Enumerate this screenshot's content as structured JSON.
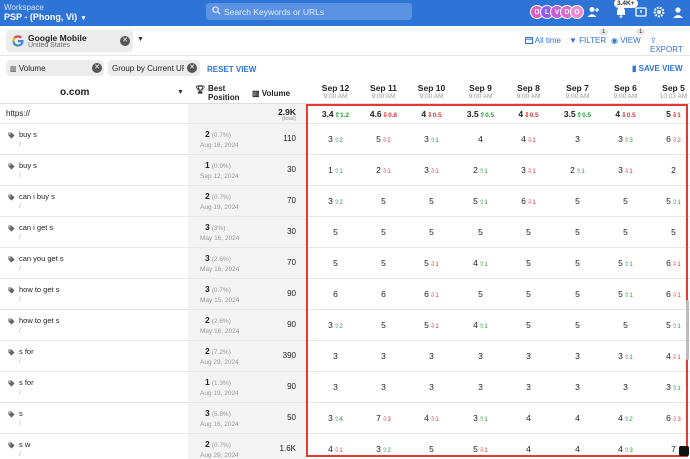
{
  "topbar": {
    "workspace_label": "Workspace",
    "workspace_name": "PSP - (Phong, Vi)",
    "search_placeholder": "Search Keywords or URLs",
    "avatars": [
      {
        "letter": "D",
        "color": "#e05cc8"
      },
      {
        "letter": "L",
        "color": "#8e5cf0"
      },
      {
        "letter": "V",
        "color": "#c85cd8"
      },
      {
        "letter": "D",
        "color": "#d86ad0"
      },
      {
        "letter": "O",
        "color": "#e88ad8"
      }
    ],
    "notif_badge": "3.4K+"
  },
  "filterbar": {
    "engine_name": "Google Mobile",
    "engine_location": "United States",
    "all_time": "All time",
    "filter": "FILTER",
    "filter_count": "1",
    "view": "VIEW",
    "view_count": "1",
    "export": "EXPORT"
  },
  "secbar": {
    "chip_volume": "Volume",
    "chip_group": "Group by Current URL",
    "reset": "RESET VIEW",
    "save": "SAVE VIEW"
  },
  "table": {
    "domain": "o.com",
    "best_header_1": "Best",
    "best_header_2": "Position",
    "volume_header": "Volume",
    "dates": [
      {
        "date": "Sep 12",
        "time": "9:00 AM"
      },
      {
        "date": "Sep 11",
        "time": "9:00 AM"
      },
      {
        "date": "Sep 10",
        "time": "9:00 AM"
      },
      {
        "date": "Sep 9",
        "time": "9:00 AM"
      },
      {
        "date": "Sep 8",
        "time": "9:00 AM"
      },
      {
        "date": "Sep 7",
        "time": "9:00 AM"
      },
      {
        "date": "Sep 6",
        "time": "9:00 AM"
      },
      {
        "date": "Sep 5",
        "time": "10:03 AM"
      }
    ],
    "top_row": {
      "url": "https://",
      "total": "2.9K",
      "total_label": "(total)",
      "cells": [
        {
          "v": "3.4",
          "c": "1.2",
          "d": "up"
        },
        {
          "v": "4.6",
          "c": "0.6",
          "d": "dn"
        },
        {
          "v": "4",
          "c": "0.5",
          "d": "dn"
        },
        {
          "v": "3.5",
          "c": "0.5",
          "d": "up"
        },
        {
          "v": "4",
          "c": "0.5",
          "d": "dn"
        },
        {
          "v": "3.5",
          "c": "0.5",
          "d": "up"
        },
        {
          "v": "4",
          "c": "0.5",
          "d": "dn"
        },
        {
          "v": "5",
          "c": "1",
          "d": "dn"
        }
      ]
    },
    "rows": [
      {
        "kw": "buy s",
        "url": "/",
        "best": "2",
        "pct": "(0.7%)",
        "bdate": "Aug 16, 2024",
        "vol": "110",
        "cells": [
          {
            "v": "3",
            "c": "2",
            "d": "up"
          },
          {
            "v": "5",
            "c": "2",
            "d": "dn"
          },
          {
            "v": "3",
            "c": "1",
            "d": "up"
          },
          {
            "v": "4",
            "c": "",
            "d": ""
          },
          {
            "v": "4",
            "c": "1",
            "d": "dn"
          },
          {
            "v": "3",
            "c": "",
            "d": ""
          },
          {
            "v": "3",
            "c": "3",
            "d": "up"
          },
          {
            "v": "6",
            "c": "2",
            "d": "dn"
          }
        ]
      },
      {
        "kw": "buy s",
        "url": "/",
        "best": "1",
        "pct": "(0.9%)",
        "bdate": "Sep 12, 2024",
        "vol": "30",
        "cells": [
          {
            "v": "1",
            "c": "1",
            "d": "up"
          },
          {
            "v": "2",
            "c": "1",
            "d": "dn"
          },
          {
            "v": "3",
            "c": "1",
            "d": "dn"
          },
          {
            "v": "2",
            "c": "1",
            "d": "up"
          },
          {
            "v": "3",
            "c": "1",
            "d": "dn"
          },
          {
            "v": "2",
            "c": "1",
            "d": "up"
          },
          {
            "v": "3",
            "c": "1",
            "d": "dn"
          },
          {
            "v": "2",
            "c": "",
            "d": ""
          }
        ]
      },
      {
        "kw": "can i buy s",
        "url": "/",
        "best": "2",
        "pct": "(0.7%)",
        "bdate": "Aug 19, 2024",
        "vol": "70",
        "cells": [
          {
            "v": "3",
            "c": "2",
            "d": "up"
          },
          {
            "v": "5",
            "c": "",
            "d": ""
          },
          {
            "v": "5",
            "c": "",
            "d": ""
          },
          {
            "v": "5",
            "c": "1",
            "d": "up"
          },
          {
            "v": "6",
            "c": "1",
            "d": "dn"
          },
          {
            "v": "5",
            "c": "",
            "d": ""
          },
          {
            "v": "5",
            "c": "",
            "d": ""
          },
          {
            "v": "5",
            "c": "1",
            "d": "up"
          }
        ]
      },
      {
        "kw": "can i get s",
        "url": "/",
        "best": "3",
        "pct": "(3%)",
        "bdate": "May 16, 2024",
        "vol": "30",
        "cells": [
          {
            "v": "5",
            "c": "",
            "d": ""
          },
          {
            "v": "5",
            "c": "",
            "d": ""
          },
          {
            "v": "5",
            "c": "",
            "d": ""
          },
          {
            "v": "5",
            "c": "",
            "d": ""
          },
          {
            "v": "5",
            "c": "",
            "d": ""
          },
          {
            "v": "5",
            "c": "",
            "d": ""
          },
          {
            "v": "5",
            "c": "",
            "d": ""
          },
          {
            "v": "5",
            "c": "",
            "d": ""
          }
        ]
      },
      {
        "kw": "can you get s",
        "url": "/",
        "best": "3",
        "pct": "(2.6%)",
        "bdate": "May 16, 2024",
        "vol": "70",
        "cells": [
          {
            "v": "5",
            "c": "",
            "d": ""
          },
          {
            "v": "5",
            "c": "",
            "d": ""
          },
          {
            "v": "5",
            "c": "1",
            "d": "dn"
          },
          {
            "v": "4",
            "c": "1",
            "d": "up"
          },
          {
            "v": "5",
            "c": "",
            "d": ""
          },
          {
            "v": "5",
            "c": "",
            "d": ""
          },
          {
            "v": "5",
            "c": "1",
            "d": "up"
          },
          {
            "v": "6",
            "c": "1",
            "d": "dn"
          }
        ]
      },
      {
        "kw": "how to get s",
        "url": "/",
        "best": "3",
        "pct": "(0.7%)",
        "bdate": "May 15, 2024",
        "vol": "90",
        "cells": [
          {
            "v": "6",
            "c": "",
            "d": ""
          },
          {
            "v": "6",
            "c": "",
            "d": ""
          },
          {
            "v": "6",
            "c": "1",
            "d": "dn"
          },
          {
            "v": "5",
            "c": "",
            "d": ""
          },
          {
            "v": "5",
            "c": "",
            "d": ""
          },
          {
            "v": "5",
            "c": "",
            "d": ""
          },
          {
            "v": "5",
            "c": "1",
            "d": "up"
          },
          {
            "v": "6",
            "c": "1",
            "d": "dn"
          }
        ]
      },
      {
        "kw": "how to get s",
        "url": "/",
        "best": "2",
        "pct": "(2.6%)",
        "bdate": "May 16, 2024",
        "vol": "90",
        "cells": [
          {
            "v": "3",
            "c": "2",
            "d": "up"
          },
          {
            "v": "5",
            "c": "",
            "d": ""
          },
          {
            "v": "5",
            "c": "1",
            "d": "dn"
          },
          {
            "v": "4",
            "c": "1",
            "d": "up"
          },
          {
            "v": "5",
            "c": "",
            "d": ""
          },
          {
            "v": "5",
            "c": "",
            "d": ""
          },
          {
            "v": "5",
            "c": "",
            "d": ""
          },
          {
            "v": "5",
            "c": "1",
            "d": "up"
          }
        ]
      },
      {
        "kw": "s for",
        "url": "/",
        "best": "2",
        "pct": "(7.2%)",
        "bdate": "Aug 29, 2024",
        "vol": "390",
        "cells": [
          {
            "v": "3",
            "c": "",
            "d": ""
          },
          {
            "v": "3",
            "c": "",
            "d": ""
          },
          {
            "v": "3",
            "c": "",
            "d": ""
          },
          {
            "v": "3",
            "c": "",
            "d": ""
          },
          {
            "v": "3",
            "c": "",
            "d": ""
          },
          {
            "v": "3",
            "c": "",
            "d": ""
          },
          {
            "v": "3",
            "c": "1",
            "d": "up"
          },
          {
            "v": "4",
            "c": "1",
            "d": "dn"
          }
        ]
      },
      {
        "kw": "s for",
        "url": "/",
        "best": "1",
        "pct": "(1.3%)",
        "bdate": "Aug 19, 2024",
        "vol": "90",
        "cells": [
          {
            "v": "3",
            "c": "",
            "d": ""
          },
          {
            "v": "3",
            "c": "",
            "d": ""
          },
          {
            "v": "3",
            "c": "",
            "d": ""
          },
          {
            "v": "3",
            "c": "",
            "d": ""
          },
          {
            "v": "3",
            "c": "",
            "d": ""
          },
          {
            "v": "3",
            "c": "",
            "d": ""
          },
          {
            "v": "3",
            "c": "",
            "d": ""
          },
          {
            "v": "3",
            "c": "1",
            "d": "up"
          }
        ]
      },
      {
        "kw": "s",
        "url": "/",
        "best": "3",
        "pct": "(5.8%)",
        "bdate": "Aug 16, 2024",
        "vol": "50",
        "cells": [
          {
            "v": "3",
            "c": "4",
            "d": "up"
          },
          {
            "v": "7",
            "c": "3",
            "d": "dn"
          },
          {
            "v": "4",
            "c": "1",
            "d": "dn"
          },
          {
            "v": "3",
            "c": "1",
            "d": "up"
          },
          {
            "v": "4",
            "c": "",
            "d": ""
          },
          {
            "v": "4",
            "c": "",
            "d": ""
          },
          {
            "v": "4",
            "c": "2",
            "d": "up"
          },
          {
            "v": "6",
            "c": "3",
            "d": "dn"
          }
        ]
      },
      {
        "kw": "s w",
        "url": "/",
        "best": "2",
        "pct": "(0.7%)",
        "bdate": "Aug 29, 2024",
        "vol": "1.6K",
        "cells": [
          {
            "v": "4",
            "c": "1",
            "d": "dn"
          },
          {
            "v": "3",
            "c": "2",
            "d": "up"
          },
          {
            "v": "5",
            "c": "",
            "d": ""
          },
          {
            "v": "5",
            "c": "1",
            "d": "dn"
          },
          {
            "v": "4",
            "c": "",
            "d": ""
          },
          {
            "v": "4",
            "c": "",
            "d": ""
          },
          {
            "v": "4",
            "c": "3",
            "d": "up"
          },
          {
            "v": "7",
            "c": "",
            "d": ""
          }
        ]
      }
    ]
  },
  "colors": {
    "brand": "#2e73d6",
    "up": "#2a9d3a",
    "down": "#d63a3a",
    "highlight_box": "#e53935"
  }
}
